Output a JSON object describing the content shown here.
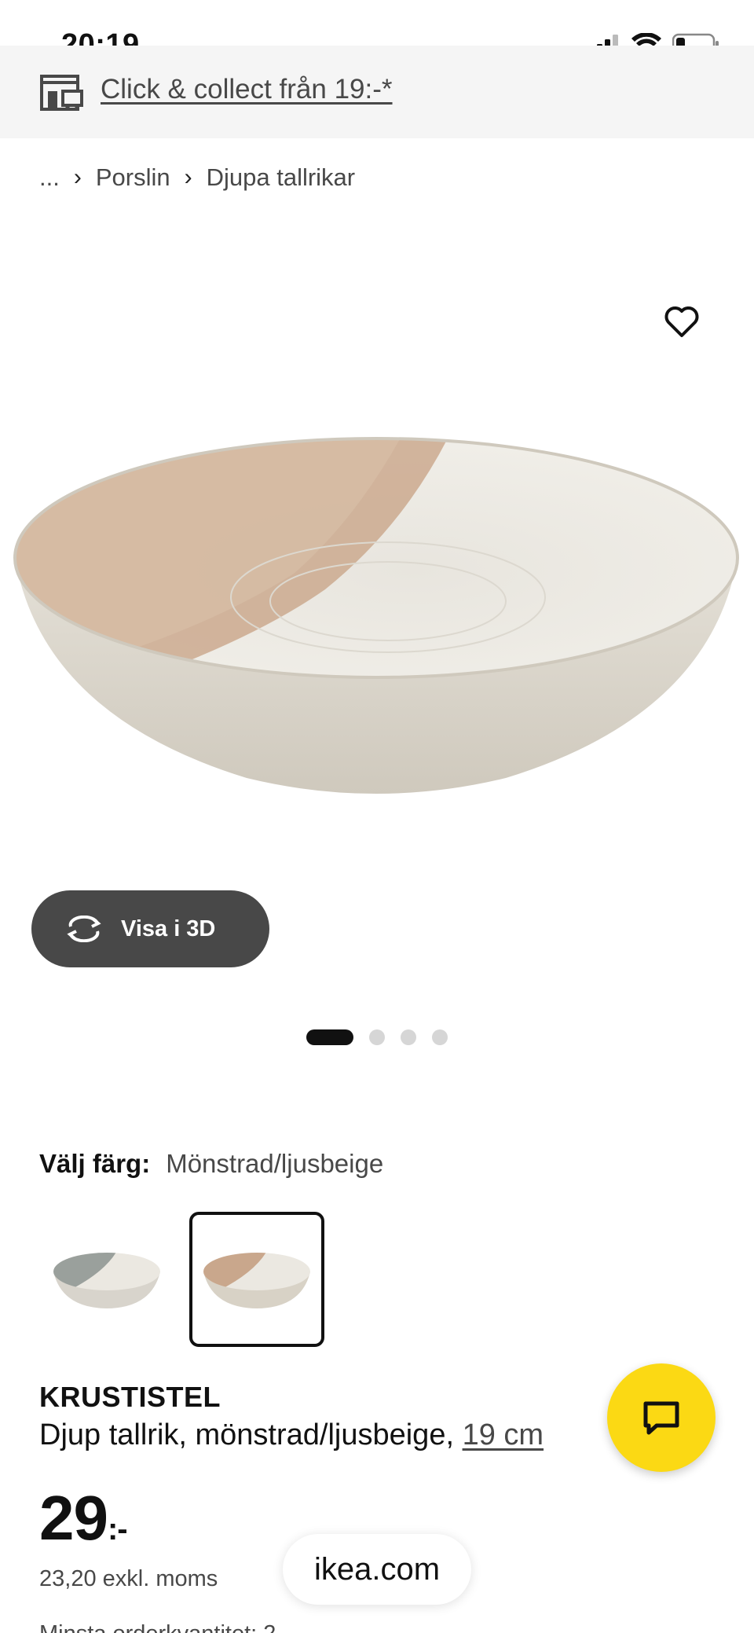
{
  "status_bar": {
    "time": "20:19"
  },
  "collect": {
    "text": "Click & collect från 19:-*"
  },
  "breadcrumb": {
    "items": [
      "...",
      "Porslin",
      "Djupa tallrikar"
    ]
  },
  "gallery": {
    "view3d_label": "Visa i 3D",
    "image_count": 4,
    "active_index": 0
  },
  "color": {
    "label": "Välj färg:",
    "value": "Mönstrad/ljusbeige",
    "options_count": 2,
    "selected_index": 1
  },
  "product": {
    "name": "KRUSTISTEL",
    "description": "Djup tallrik, mönstrad/ljusbeige, ",
    "size": "19 cm",
    "price": "29",
    "price_suffix": ":-",
    "price_ex_vat": "23,20 exkl. moms",
    "min_order": "Minsta orderkvantitet: 2"
  },
  "browser": {
    "url": "ikea.com"
  },
  "colors": {
    "chat_fab": "#fbd914",
    "button_dark": "#484848"
  }
}
